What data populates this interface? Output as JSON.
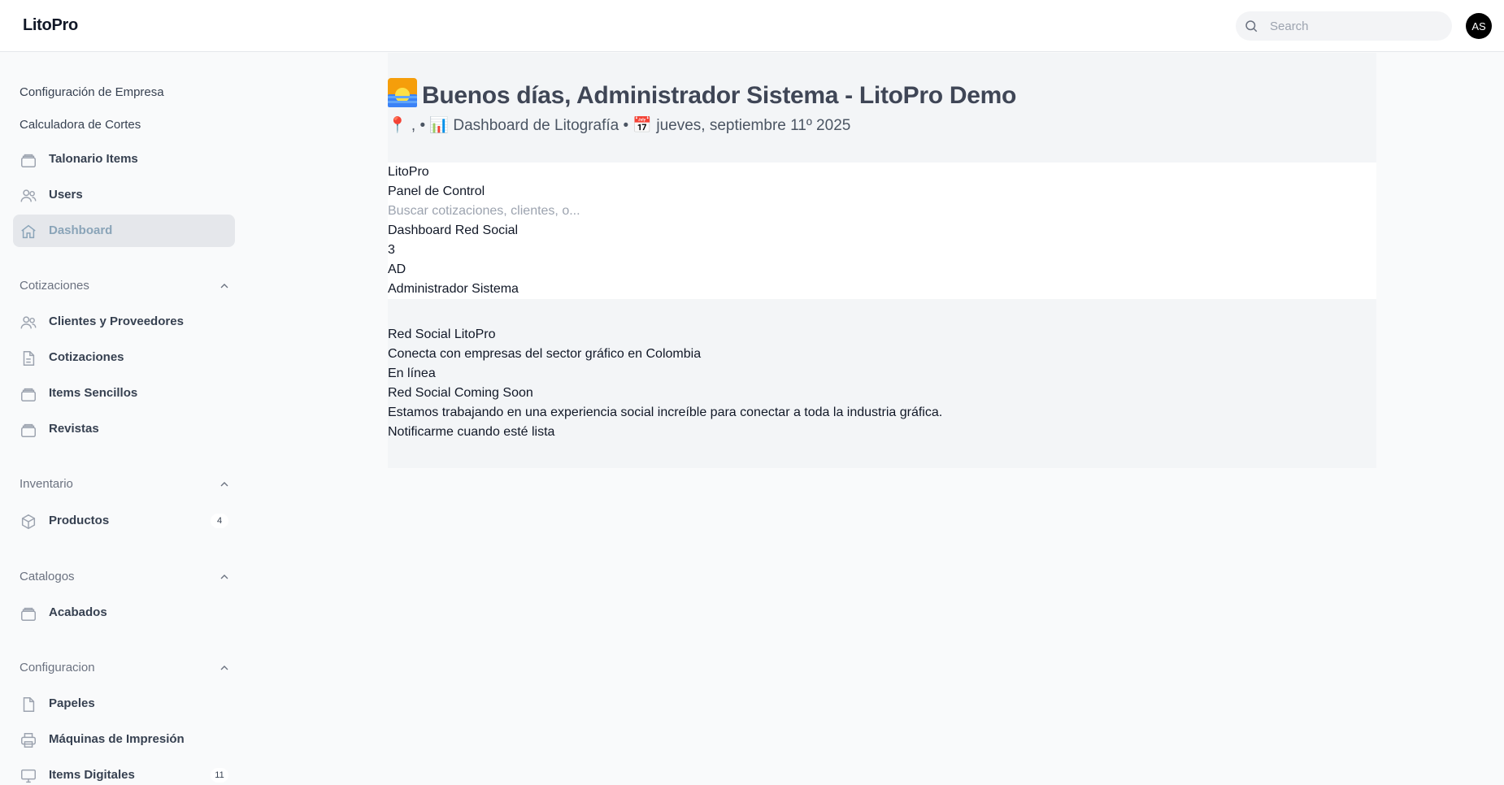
{
  "app": {
    "brand": "LitoPro"
  },
  "topbar": {
    "search_placeholder": "Search",
    "avatar_initials": "AS"
  },
  "sidebar": {
    "plain_links": [
      "Configuración de Empresa",
      "Calculadora de Cortes"
    ],
    "top_items": [
      {
        "label": "Talonario Items",
        "icon": "stack-icon"
      },
      {
        "label": "Users",
        "icon": "users-icon"
      },
      {
        "label": "Dashboard",
        "icon": "home-icon",
        "active": true
      }
    ],
    "groups": [
      {
        "label": "Cotizaciones",
        "items": [
          {
            "label": "Clientes y Proveedores",
            "icon": "users-icon"
          },
          {
            "label": "Cotizaciones",
            "icon": "document-icon"
          },
          {
            "label": "Items Sencillos",
            "icon": "stack-icon"
          },
          {
            "label": "Revistas",
            "icon": "stack-icon"
          }
        ]
      },
      {
        "label": "Inventario",
        "items": [
          {
            "label": "Productos",
            "icon": "cube-icon",
            "badge": "4"
          }
        ]
      },
      {
        "label": "Catalogos",
        "items": [
          {
            "label": "Acabados",
            "icon": "stack-icon"
          }
        ]
      },
      {
        "label": "Configuracion",
        "items": [
          {
            "label": "Papeles",
            "icon": "document-icon"
          },
          {
            "label": "Máquinas de Impresión",
            "icon": "printer-icon"
          },
          {
            "label": "Items Digitales",
            "icon": "monitor-icon",
            "badge": "11"
          }
        ]
      }
    ]
  },
  "main": {
    "greeting": "Buenos días, Administrador Sistema - LitoPro Demo",
    "subtitle": "📍 , • 📊 Dashboard de Litografía • 📅 jueves, septiembre 11º 2025",
    "panel": {
      "brand": "LitoPro",
      "title": "Panel de Control",
      "search_placeholder": "Buscar cotizaciones, clientes, o...",
      "social_link": "Dashboard Red Social",
      "notification_count": "3",
      "user_initials": "AD",
      "user_name": "Administrador Sistema"
    },
    "social": {
      "title": "Red Social LitoPro",
      "description": "Conecta con empresas del sector gráfico en Colombia",
      "status": "En línea",
      "coming_soon": "Red Social Coming Soon",
      "message": "Estamos trabajando en una experiencia social increíble para conectar a toda la industria gráfica.",
      "notify_button": "Notificarme cuando esté lista"
    }
  },
  "colors": {
    "active_nav_text": "#8aa4b8",
    "active_nav_bg": "#e5e7eb",
    "heading": "#3f4656"
  }
}
